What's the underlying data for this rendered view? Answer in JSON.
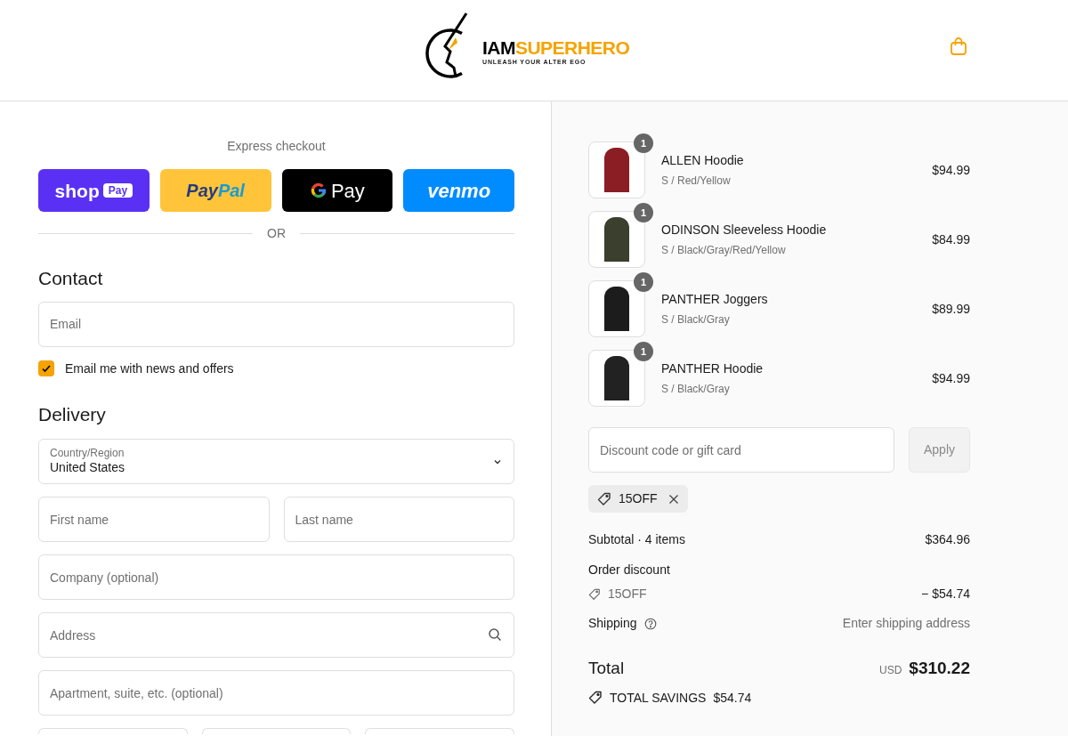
{
  "header": {
    "logo": {
      "word_1": "IAM",
      "word_2": "SUPERHERO",
      "tagline": "UNLEASH YOUR ALTER EGO"
    }
  },
  "express_checkout": {
    "title": "Express checkout",
    "buttons": [
      {
        "kind": "shop_pay",
        "text": "shop",
        "badge": "Pay"
      },
      {
        "kind": "paypal",
        "text": "Pay",
        "text_2": "Pal"
      },
      {
        "kind": "google_pay",
        "text": "Pay"
      },
      {
        "kind": "venmo",
        "text": "venmo"
      }
    ],
    "divider": "OR"
  },
  "contact": {
    "heading": "Contact",
    "email": {
      "placeholder": "Email"
    },
    "news_checkbox": {
      "label": "Email me with news and offers",
      "checked": true
    }
  },
  "delivery": {
    "heading": "Delivery",
    "country": {
      "label": "Country/Region",
      "value": "United States"
    },
    "fields": [
      [
        {
          "placeholder": "First name"
        },
        {
          "placeholder": "Last name"
        }
      ],
      [
        {
          "placeholder": "Company (optional)"
        }
      ],
      [
        {
          "placeholder": "Address",
          "search": true
        }
      ],
      [
        {
          "placeholder": "Apartment, suite, etc. (optional)"
        }
      ],
      [
        {
          "kind": "cut_off"
        },
        {
          "kind": "cut_off"
        },
        {
          "kind": "cut_off"
        }
      ]
    ]
  },
  "order": {
    "items": [
      {
        "quantity": "1",
        "name": "ALLEN Hoodie",
        "variant": "S / Red/Yellow",
        "price": "$94.99",
        "color": "#8b1e24"
      },
      {
        "quantity": "1",
        "name": "ODINSON Sleeveless Hoodie",
        "variant": "S / Black/Gray/Red/Yellow",
        "price": "$84.99",
        "color": "#3a3f2e"
      },
      {
        "quantity": "1",
        "name": "PANTHER Joggers",
        "variant": "S / Black/Gray",
        "price": "$89.99",
        "color": "#1c1c1c"
      },
      {
        "quantity": "1",
        "name": "PANTHER Hoodie",
        "variant": "S / Black/Gray",
        "price": "$94.99",
        "color": "#222222"
      }
    ],
    "discount": {
      "placeholder": "Discount code or gift card",
      "apply": "Apply",
      "apply_disabled": true,
      "applied_code": "15OFF"
    },
    "summary": {
      "subtotal_label": "Subtotal",
      "separator": "·",
      "item_count": "4 items",
      "subtotal": "$364.96",
      "discount_label": "Order discount",
      "discount_code": "15OFF",
      "discount_amount": "− $54.74",
      "shipping_label": "Shipping",
      "shipping_value": "Enter shipping address",
      "total_label": "Total",
      "currency": "USD",
      "total": "$310.22",
      "savings_label": "TOTAL SAVINGS",
      "savings": "$54.74"
    }
  }
}
